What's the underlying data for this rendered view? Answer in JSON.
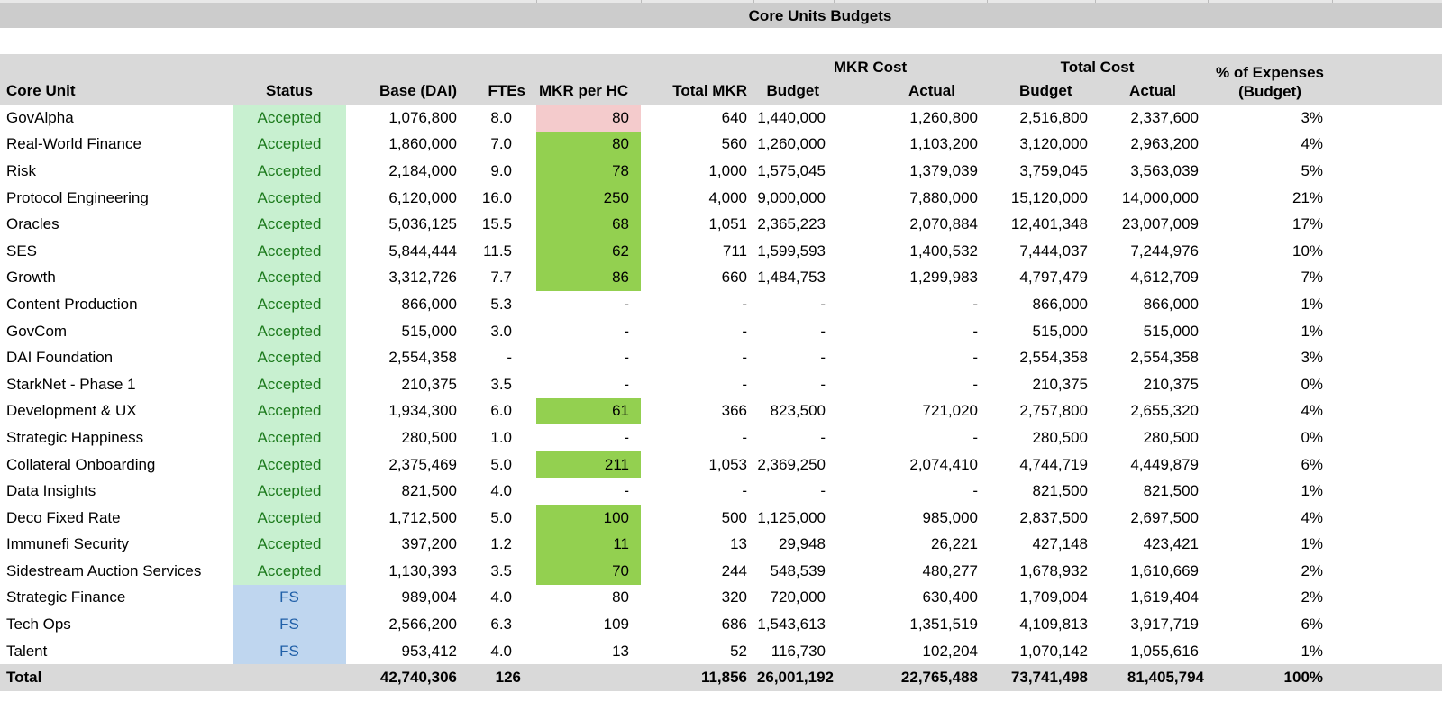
{
  "title": "Core Units Budgets",
  "headers": {
    "core_unit": "Core Unit",
    "status": "Status",
    "base": "Base (DAI)",
    "ftes": "FTEs",
    "mkr_per_hc": "MKR per HC",
    "total_mkr": "Total MKR",
    "mkr_cost": "MKR Cost",
    "total_cost": "Total Cost",
    "budget": "Budget",
    "actual": "Actual",
    "pct_line1": "% of Expenses",
    "pct_line2": "(Budget)"
  },
  "colors": {
    "accepted_bg": "#c8f0d0",
    "accepted_text": "#1c7a1c",
    "fs_bg": "#bfd6ef",
    "fs_text": "#2160a8",
    "mkr_green": "#93d050",
    "mkr_pink": "#f4cbcc",
    "header_bg": "#d9d9d9"
  },
  "rows": [
    {
      "name": "GovAlpha",
      "status": "Accepted",
      "base": "1,076,800",
      "ftes": "8.0",
      "mkr_per_hc": "80",
      "mkr_highlight": "pink",
      "total_mkr": "640",
      "mkr_budget": "1,440,000",
      "mkr_actual": "1,260,800",
      "total_budget": "2,516,800",
      "total_actual": "2,337,600",
      "pct": "3%"
    },
    {
      "name": "Real-World Finance",
      "status": "Accepted",
      "base": "1,860,000",
      "ftes": "7.0",
      "mkr_per_hc": "80",
      "mkr_highlight": "green",
      "total_mkr": "560",
      "mkr_budget": "1,260,000",
      "mkr_actual": "1,103,200",
      "total_budget": "3,120,000",
      "total_actual": "2,963,200",
      "pct": "4%"
    },
    {
      "name": "Risk",
      "status": "Accepted",
      "base": "2,184,000",
      "ftes": "9.0",
      "mkr_per_hc": "78",
      "mkr_highlight": "green",
      "total_mkr": "1,000",
      "mkr_budget": "1,575,045",
      "mkr_actual": "1,379,039",
      "total_budget": "3,759,045",
      "total_actual": "3,563,039",
      "pct": "5%"
    },
    {
      "name": "Protocol Engineering",
      "status": "Accepted",
      "base": "6,120,000",
      "ftes": "16.0",
      "mkr_per_hc": "250",
      "mkr_highlight": "green",
      "total_mkr": "4,000",
      "mkr_budget": "9,000,000",
      "mkr_actual": "7,880,000",
      "total_budget": "15,120,000",
      "total_actual": "14,000,000",
      "pct": "21%"
    },
    {
      "name": "Oracles",
      "status": "Accepted",
      "base": "5,036,125",
      "ftes": "15.5",
      "mkr_per_hc": "68",
      "mkr_highlight": "green",
      "total_mkr": "1,051",
      "mkr_budget": "2,365,223",
      "mkr_actual": "2,070,884",
      "total_budget": "12,401,348",
      "total_actual": "23,007,009",
      "pct": "17%"
    },
    {
      "name": "SES",
      "status": "Accepted",
      "base": "5,844,444",
      "ftes": "11.5",
      "mkr_per_hc": "62",
      "mkr_highlight": "green",
      "total_mkr": "711",
      "mkr_budget": "1,599,593",
      "mkr_actual": "1,400,532",
      "total_budget": "7,444,037",
      "total_actual": "7,244,976",
      "pct": "10%"
    },
    {
      "name": "Growth",
      "status": "Accepted",
      "base": "3,312,726",
      "ftes": "7.7",
      "mkr_per_hc": "86",
      "mkr_highlight": "green",
      "total_mkr": "660",
      "mkr_budget": "1,484,753",
      "mkr_actual": "1,299,983",
      "total_budget": "4,797,479",
      "total_actual": "4,612,709",
      "pct": "7%"
    },
    {
      "name": "Content Production",
      "status": "Accepted",
      "base": "866,000",
      "ftes": "5.3",
      "mkr_per_hc": "-",
      "mkr_highlight": null,
      "total_mkr": "-",
      "mkr_budget": "-",
      "mkr_actual": "-",
      "total_budget": "866,000",
      "total_actual": "866,000",
      "pct": "1%"
    },
    {
      "name": "GovCom",
      "status": "Accepted",
      "base": "515,000",
      "ftes": "3.0",
      "mkr_per_hc": "-",
      "mkr_highlight": null,
      "total_mkr": "-",
      "mkr_budget": "-",
      "mkr_actual": "-",
      "total_budget": "515,000",
      "total_actual": "515,000",
      "pct": "1%"
    },
    {
      "name": "DAI Foundation",
      "status": "Accepted",
      "base": "2,554,358",
      "ftes": "-",
      "mkr_per_hc": "-",
      "mkr_highlight": null,
      "total_mkr": "-",
      "mkr_budget": "-",
      "mkr_actual": "-",
      "total_budget": "2,554,358",
      "total_actual": "2,554,358",
      "pct": "3%"
    },
    {
      "name": "StarkNet - Phase 1",
      "status": "Accepted",
      "base": "210,375",
      "ftes": "3.5",
      "mkr_per_hc": "-",
      "mkr_highlight": null,
      "total_mkr": "-",
      "mkr_budget": "-",
      "mkr_actual": "-",
      "total_budget": "210,375",
      "total_actual": "210,375",
      "pct": "0%"
    },
    {
      "name": "Development & UX",
      "status": "Accepted",
      "base": "1,934,300",
      "ftes": "6.0",
      "mkr_per_hc": "61",
      "mkr_highlight": "green",
      "total_mkr": "366",
      "mkr_budget": "823,500",
      "mkr_actual": "721,020",
      "total_budget": "2,757,800",
      "total_actual": "2,655,320",
      "pct": "4%"
    },
    {
      "name": "Strategic Happiness",
      "status": "Accepted",
      "base": "280,500",
      "ftes": "1.0",
      "mkr_per_hc": "-",
      "mkr_highlight": null,
      "total_mkr": "-",
      "mkr_budget": "-",
      "mkr_actual": "-",
      "total_budget": "280,500",
      "total_actual": "280,500",
      "pct": "0%"
    },
    {
      "name": "Collateral Onboarding",
      "status": "Accepted",
      "base": "2,375,469",
      "ftes": "5.0",
      "mkr_per_hc": "211",
      "mkr_highlight": "green",
      "total_mkr": "1,053",
      "mkr_budget": "2,369,250",
      "mkr_actual": "2,074,410",
      "total_budget": "4,744,719",
      "total_actual": "4,449,879",
      "pct": "6%"
    },
    {
      "name": "Data Insights",
      "status": "Accepted",
      "base": "821,500",
      "ftes": "4.0",
      "mkr_per_hc": "-",
      "mkr_highlight": null,
      "total_mkr": "-",
      "mkr_budget": "-",
      "mkr_actual": "-",
      "total_budget": "821,500",
      "total_actual": "821,500",
      "pct": "1%"
    },
    {
      "name": "Deco Fixed Rate",
      "status": "Accepted",
      "base": "1,712,500",
      "ftes": "5.0",
      "mkr_per_hc": "100",
      "mkr_highlight": "green",
      "total_mkr": "500",
      "mkr_budget": "1,125,000",
      "mkr_actual": "985,000",
      "total_budget": "2,837,500",
      "total_actual": "2,697,500",
      "pct": "4%"
    },
    {
      "name": "Immunefi Security",
      "status": "Accepted",
      "base": "397,200",
      "ftes": "1.2",
      "mkr_per_hc": "11",
      "mkr_highlight": "green",
      "total_mkr": "13",
      "mkr_budget": "29,948",
      "mkr_actual": "26,221",
      "total_budget": "427,148",
      "total_actual": "423,421",
      "pct": "1%"
    },
    {
      "name": "Sidestream Auction Services",
      "status": "Accepted",
      "base": "1,130,393",
      "ftes": "3.5",
      "mkr_per_hc": "70",
      "mkr_highlight": "green",
      "total_mkr": "244",
      "mkr_budget": "548,539",
      "mkr_actual": "480,277",
      "total_budget": "1,678,932",
      "total_actual": "1,610,669",
      "pct": "2%"
    },
    {
      "name": "Strategic Finance",
      "status": "FS",
      "base": "989,004",
      "ftes": "4.0",
      "mkr_per_hc": "80",
      "mkr_highlight": null,
      "total_mkr": "320",
      "mkr_budget": "720,000",
      "mkr_actual": "630,400",
      "total_budget": "1,709,004",
      "total_actual": "1,619,404",
      "pct": "2%"
    },
    {
      "name": "Tech Ops",
      "status": "FS",
      "base": "2,566,200",
      "ftes": "6.3",
      "mkr_per_hc": "109",
      "mkr_highlight": null,
      "total_mkr": "686",
      "mkr_budget": "1,543,613",
      "mkr_actual": "1,351,519",
      "total_budget": "4,109,813",
      "total_actual": "3,917,719",
      "pct": "6%"
    },
    {
      "name": "Talent",
      "status": "FS",
      "base": "953,412",
      "ftes": "4.0",
      "mkr_per_hc": "13",
      "mkr_highlight": null,
      "total_mkr": "52",
      "mkr_budget": "116,730",
      "mkr_actual": "102,204",
      "total_budget": "1,070,142",
      "total_actual": "1,055,616",
      "pct": "1%"
    }
  ],
  "total": {
    "label": "Total",
    "base": "42,740,306",
    "ftes": "126",
    "total_mkr": "11,856",
    "mkr_budget": "26,001,192",
    "mkr_actual": "22,765,488",
    "total_budget": "73,741,498",
    "total_actual": "81,405,794",
    "pct": "100%"
  }
}
